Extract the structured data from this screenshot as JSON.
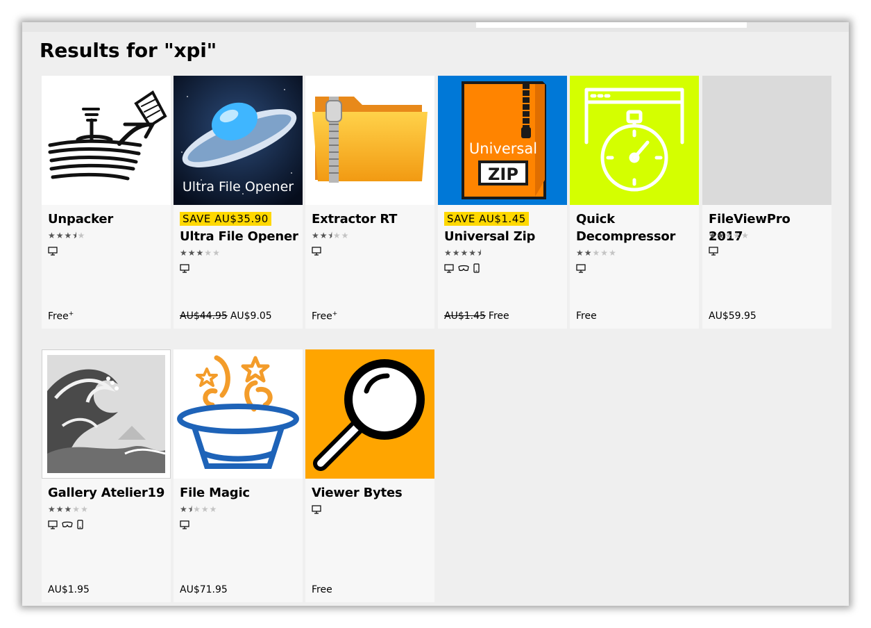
{
  "page_title": "Results for \"xpi\"",
  "colors": {
    "sale_badge": "#ffd800",
    "card_bg": "#f7f7f7",
    "page_bg": "#efefef"
  },
  "apps": [
    {
      "name": "Unpacker",
      "rating": 3.5,
      "devices": [
        "pc"
      ],
      "price": "Free",
      "price_mark": "+",
      "thumb_icon": "unpacker-logo-icon"
    },
    {
      "name": "Ultra File Opener",
      "badge": "SAVE AU$35.90",
      "rating": 3,
      "devices": [
        "pc"
      ],
      "old_price": "AU$44.95",
      "price": "AU$9.05",
      "thumb_text": "Ultra File Opener",
      "thumb_icon": "flying-saucer-icon"
    },
    {
      "name": "Extractor RT",
      "rating": 2.5,
      "devices": [
        "pc"
      ],
      "price": "Free",
      "price_mark": "+",
      "thumb_icon": "zipped-folder-icon"
    },
    {
      "name": "Universal Zip",
      "badge": "SAVE AU$1.45",
      "rating": 4.5,
      "devices": [
        "pc",
        "hololens",
        "mobile"
      ],
      "old_price": "AU$1.45",
      "price": "Free",
      "thumb_text_1": "Universal",
      "thumb_text_2": "ZIP",
      "thumb_icon": "universal-zip-folder-icon"
    },
    {
      "name": "Quick Decompressor",
      "rating": 2,
      "devices": [
        "pc"
      ],
      "price": "Free",
      "thumb_icon": "stopwatch-window-icon"
    },
    {
      "name": "FileViewPro 2017",
      "rating": 2,
      "devices": [
        "pc"
      ],
      "price": "AU$59.95",
      "thumb_icon": "placeholder-icon"
    },
    {
      "name": "Gallery Atelier19",
      "rating": 3,
      "devices": [
        "pc",
        "hololens",
        "mobile"
      ],
      "price": "AU$1.95",
      "thumb_icon": "great-wave-painting-icon"
    },
    {
      "name": "File Magic",
      "rating": 1.5,
      "devices": [
        "pc"
      ],
      "price": "AU$71.95",
      "thumb_icon": "magic-hat-icon"
    },
    {
      "name": "Viewer Bytes",
      "devices": [
        "pc"
      ],
      "price": "Free",
      "thumb_icon": "magnifier-icon"
    }
  ]
}
